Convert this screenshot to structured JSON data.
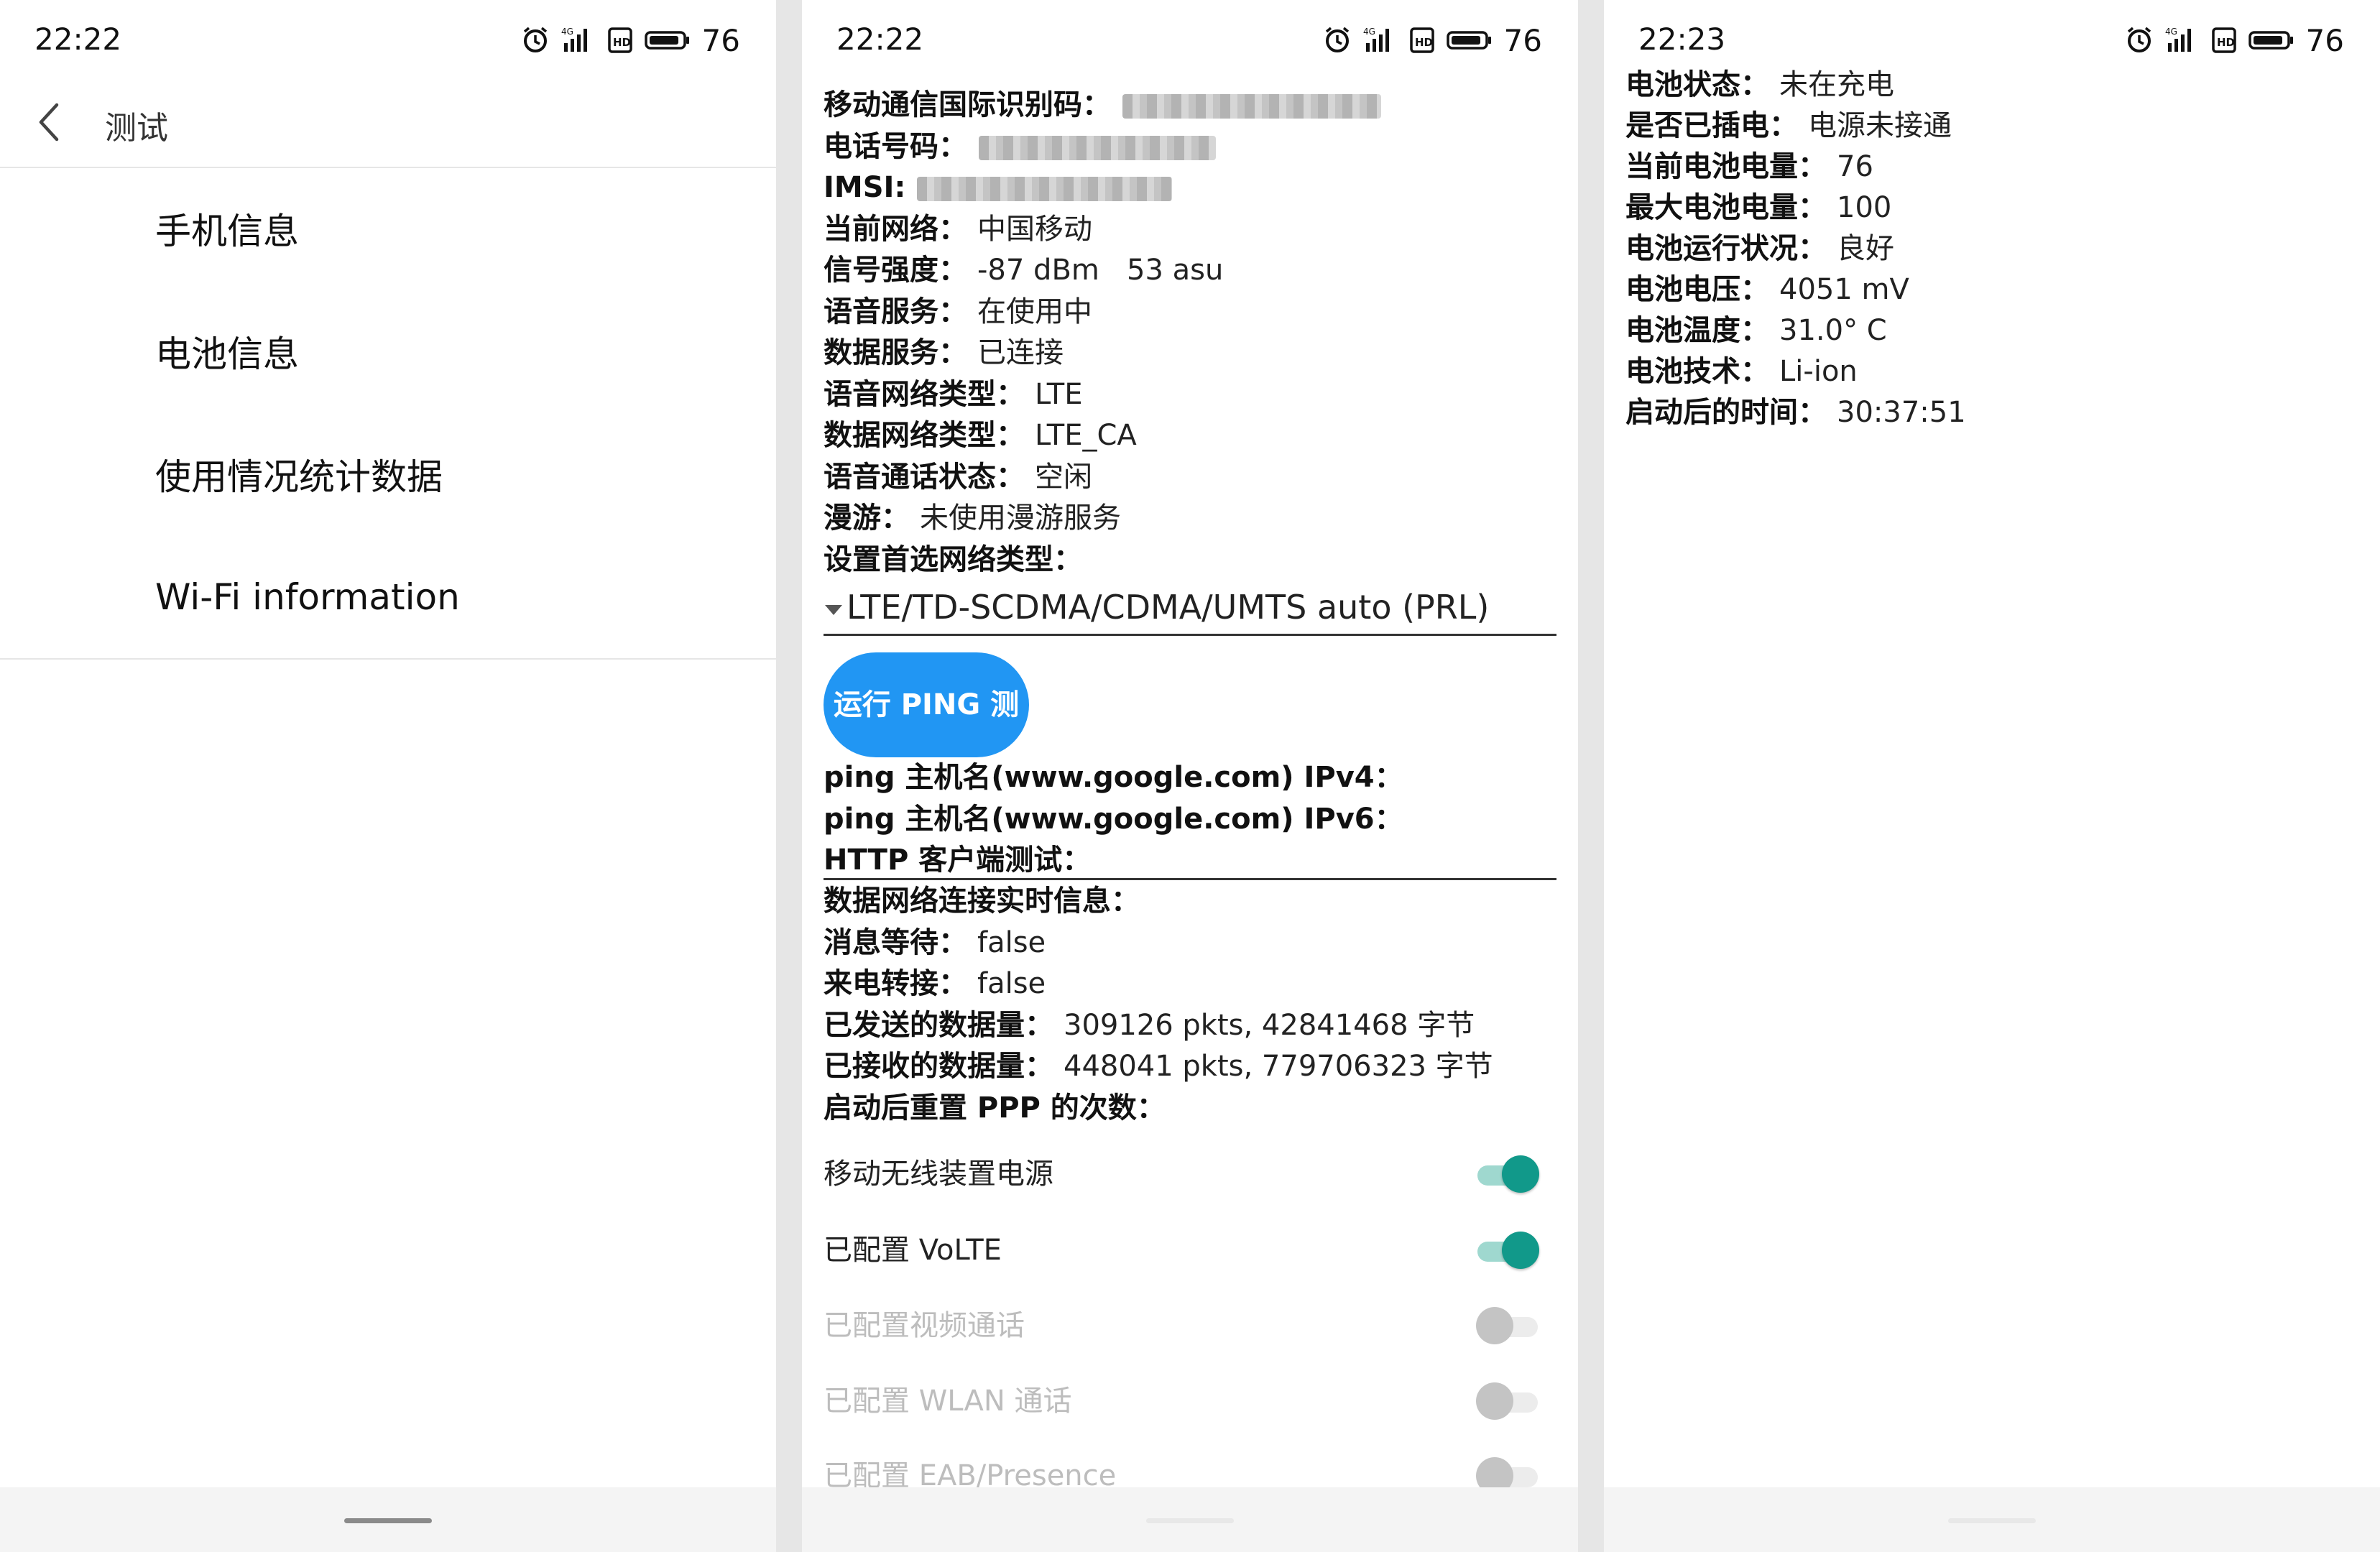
{
  "screen1": {
    "status": {
      "time": "22:22",
      "battery": "76"
    },
    "title": "测试",
    "menu": [
      "手机信息",
      "电池信息",
      "使用情况统计数据",
      "Wi-Fi information"
    ]
  },
  "screen2": {
    "status": {
      "time": "22:22",
      "battery": "76"
    },
    "rows": [
      {
        "label": "移动通信国际识别码：",
        "value": ""
      },
      {
        "label": "电话号码：",
        "value": ""
      },
      {
        "label": "IMSI:",
        "value": ""
      },
      {
        "label": "当前网络：",
        "value": "中国移动"
      },
      {
        "label": "信号强度：",
        "value": "-87 dBm   53 asu"
      },
      {
        "label": "语音服务：",
        "value": "在使用中"
      },
      {
        "label": "数据服务：",
        "value": "已连接"
      },
      {
        "label": "语音网络类型：",
        "value": "LTE"
      },
      {
        "label": "数据网络类型：",
        "value": "LTE_CA"
      },
      {
        "label": "语音通话状态：",
        "value": "空闲"
      },
      {
        "label": "漫游：",
        "value": "未使用漫游服务"
      },
      {
        "label": "设置首选网络类型：",
        "value": ""
      }
    ],
    "preferred_network": "LTE/TD-SCDMA/CDMA/UMTS auto (PRL)",
    "ping_button": "运行 PING 测试",
    "ping_rows": [
      "ping 主机名(www.google.com) IPv4：",
      "ping 主机名(www.google.com) IPv6：",
      "HTTP 客户端测试："
    ],
    "data_rows": [
      {
        "label": "数据网络连接实时信息：",
        "value": ""
      },
      {
        "label": "消息等待：",
        "value": "false"
      },
      {
        "label": "来电转接：",
        "value": "false"
      },
      {
        "label": "已发送的数据量：",
        "value": "309126 pkts, 42841468 字节"
      },
      {
        "label": "已接收的数据量：",
        "value": "448041 pkts, 779706323 字节"
      },
      {
        "label": "启动后重置 PPP 的次数：",
        "value": ""
      }
    ],
    "toggles": [
      {
        "label": "移动无线装置电源",
        "on": true,
        "enabled": true
      },
      {
        "label": "已配置 VoLTE",
        "on": true,
        "enabled": true
      },
      {
        "label": "已配置视频通话",
        "on": false,
        "enabled": false
      },
      {
        "label": "已配置 WLAN 通话",
        "on": false,
        "enabled": false
      },
      {
        "label": "已配置 EAB/Presence",
        "on": false,
        "enabled": false
      }
    ]
  },
  "screen3": {
    "status": {
      "time": "22:23",
      "battery": "76"
    },
    "rows": [
      {
        "label": "电池状态：",
        "value": "未在充电"
      },
      {
        "label": "是否已插电：",
        "value": "电源未接通"
      },
      {
        "label": "当前电池电量：",
        "value": "76"
      },
      {
        "label": "最大电池电量：",
        "value": "100"
      },
      {
        "label": "电池运行状况：",
        "value": "良好"
      },
      {
        "label": "电池电压：",
        "value": "4051 mV"
      },
      {
        "label": "电池温度：",
        "value": "31.0° C"
      },
      {
        "label": "电池技术：",
        "value": "Li-ion"
      },
      {
        "label": "启动后的时间：",
        "value": "30:37:51"
      }
    ]
  },
  "colors": {
    "accent": "#2196f3",
    "switch_on": "#11998a"
  }
}
